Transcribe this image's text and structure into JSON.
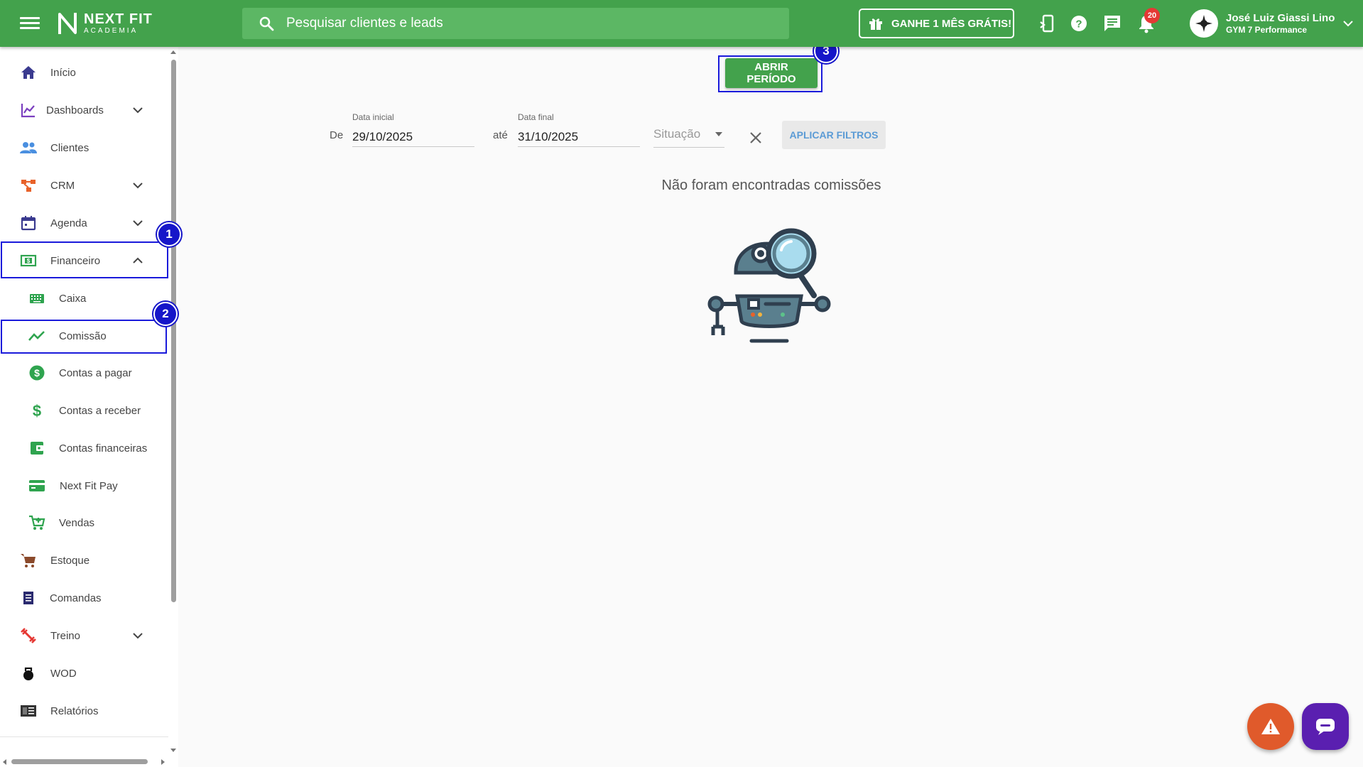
{
  "app": {
    "logo_title": "NEXT FIT",
    "logo_sub": "ACADEMIA"
  },
  "header": {
    "search_placeholder": "Pesquisar clientes e leads",
    "promo_label": "GANHE 1 MÊS GRÁTIS!",
    "notification_count": "20",
    "user_name": "José Luiz Giassi Lino",
    "user_gym": "GYM 7 Performance",
    "icons": [
      "mobile-icon",
      "help-icon",
      "chat-icon",
      "bell-icon"
    ]
  },
  "sidebar": {
    "items": [
      {
        "label": "Início",
        "icon": "home-icon"
      },
      {
        "label": "Dashboards",
        "icon": "chart-line-icon"
      },
      {
        "label": "Clientes",
        "icon": "people-icon"
      },
      {
        "label": "CRM",
        "icon": "crm-icon"
      },
      {
        "label": "Agenda",
        "icon": "calendar-icon"
      },
      {
        "label": "Financeiro",
        "icon": "money-icon"
      },
      {
        "label": "Caixa",
        "icon": "keyboard-icon"
      },
      {
        "label": "Comissão",
        "icon": "trending-icon"
      },
      {
        "label": "Contas a pagar",
        "icon": "dollar-circle-icon"
      },
      {
        "label": "Contas a receber",
        "icon": "dollar-icon"
      },
      {
        "label": "Contas financeiras",
        "icon": "wallet-icon"
      },
      {
        "label": "Next Fit Pay",
        "icon": "card-icon"
      },
      {
        "label": "Vendas",
        "icon": "cart-plus-icon"
      },
      {
        "label": "Estoque",
        "icon": "cart-icon"
      },
      {
        "label": "Comandas",
        "icon": "receipt-icon"
      },
      {
        "label": "Treino",
        "icon": "dumbbell-icon"
      },
      {
        "label": "WOD",
        "icon": "kettlebell-icon"
      },
      {
        "label": "Relatórios",
        "icon": "report-icon"
      }
    ]
  },
  "steps": [
    "1",
    "2",
    "3"
  ],
  "main": {
    "open_period_label": "ABRIR PERÍODO",
    "from_word": "De",
    "until_word": "até",
    "start_label": "Data inicial",
    "start_value": "29/10/2025",
    "end_label": "Data final",
    "end_value": "31/10/2025",
    "status_placeholder": "Situação",
    "apply_label": "APLICAR FILTROS",
    "empty_message": "Não foram encontradas comissões"
  },
  "colors": {
    "brand": "#43a24c",
    "highlight": "#1a1adb",
    "warn": "#e05a2b",
    "chat": "#5a1fb0"
  }
}
